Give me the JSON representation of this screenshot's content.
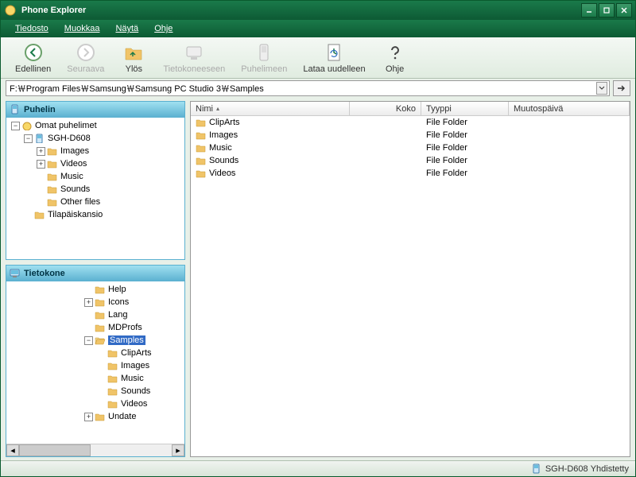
{
  "window": {
    "title": "Phone Explorer"
  },
  "menu": {
    "file": "Tiedosto",
    "edit": "Muokkaa",
    "view": "Näytä",
    "help": "Ohje"
  },
  "toolbar": {
    "back": "Edellinen",
    "forward": "Seuraava",
    "up": "Ylös",
    "toComputer": "Tietokoneeseen",
    "toPhone": "Puhelimeen",
    "reload": "Lataa uudelleen",
    "help": "Ohje"
  },
  "address": {
    "path": "F:￦Program Files￦Samsung￦Samsung PC Studio 3￦Samples"
  },
  "phonePanel": {
    "title": "Puhelin",
    "tree": {
      "root": "Omat puhelimet",
      "device": "SGH-D608",
      "images": "Images",
      "videos": "Videos",
      "music": "Music",
      "sounds": "Sounds",
      "other": "Other files",
      "temp": "Tilapäiskansio"
    }
  },
  "computerPanel": {
    "title": "Tietokone",
    "tree": {
      "help": "Help",
      "icons": "Icons",
      "lang": "Lang",
      "mdprofs": "MDProfs",
      "samples": "Samples",
      "cliparts": "ClipArts",
      "images": "Images",
      "music": "Music",
      "sounds": "Sounds",
      "videos": "Videos",
      "update": "Undate"
    }
  },
  "columns": {
    "name": "Nimi",
    "size": "Koko",
    "type": "Tyyppi",
    "modified": "Muutospäivä"
  },
  "files": [
    {
      "name": "ClipArts",
      "size": "",
      "type": "File Folder",
      "modified": ""
    },
    {
      "name": "Images",
      "size": "",
      "type": "File Folder",
      "modified": ""
    },
    {
      "name": "Music",
      "size": "",
      "type": "File Folder",
      "modified": ""
    },
    {
      "name": "Sounds",
      "size": "",
      "type": "File Folder",
      "modified": ""
    },
    {
      "name": "Videos",
      "size": "",
      "type": "File Folder",
      "modified": ""
    }
  ],
  "status": {
    "device": "SGH-D608",
    "state": "Yhdistetty"
  },
  "colors": {
    "accent": "#1a7a4a",
    "panel": "#5ab0d0"
  }
}
